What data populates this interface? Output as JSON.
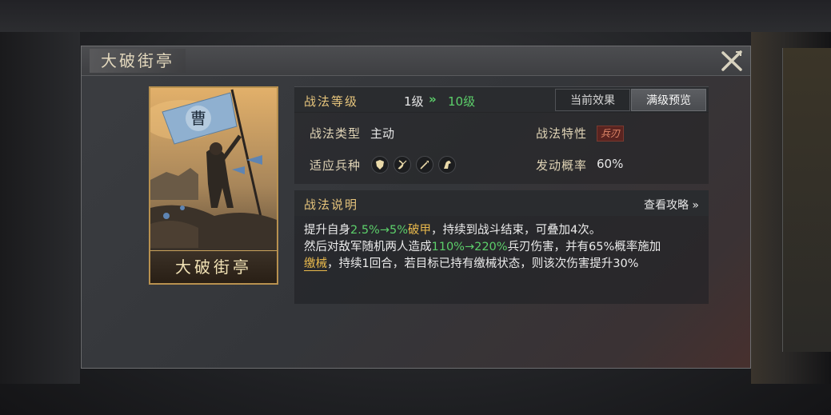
{
  "window": {
    "title": "大破街亭"
  },
  "card": {
    "name": "大破街亭",
    "flag_char": "曹"
  },
  "level": {
    "label": "战法等级",
    "from": "1级",
    "arrow": "»",
    "to": "10级"
  },
  "tabs": {
    "current": "当前效果",
    "preview": "满级预览",
    "selected": "满级预览"
  },
  "info": {
    "type_label": "战法类型",
    "type_value": "主动",
    "trait_label": "战法特性",
    "trait_value": "兵刃",
    "troops_label": "适应兵种",
    "troops_icons": [
      "shield-icon",
      "bow-icon",
      "spear-icon",
      "horse-icon"
    ],
    "chance_label": "发动概率",
    "chance_value": "60%"
  },
  "description": {
    "title": "战法说明",
    "guide_link": "查看攻略 »",
    "line1_a": "提升自身",
    "line1_b": "2.5%→5%",
    "line1_c": "破甲",
    "line1_d": "，持续到战斗结束，可叠加4次。",
    "line2_a": "然后对敌军随机两人造成",
    "line2_b": "110%→220%",
    "line2_c": "兵刃伤害，并有65%概率施加",
    "line3_a": "缴械",
    "line3_b": "，持续1回合，若目标已持有缴械状态，则该次伤害提升30%"
  },
  "colors": {
    "gold_label": "#e7c57c",
    "green_value": "#5ccf6a",
    "orange_keyword": "#e9b94c"
  }
}
